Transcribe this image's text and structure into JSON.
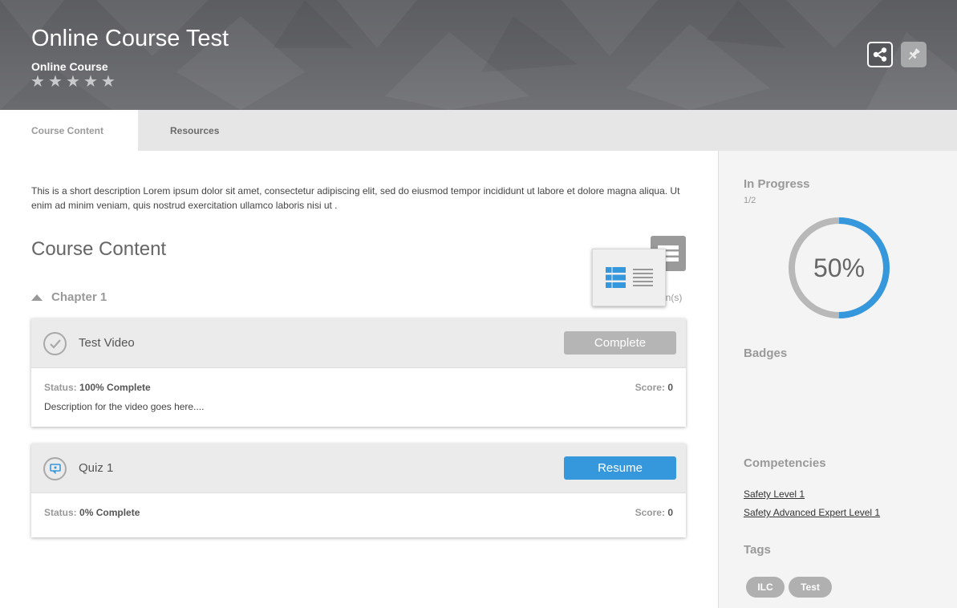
{
  "header": {
    "title": "Online Course Test",
    "type_label": "Online Course",
    "rating": {
      "stars_total": 5,
      "stars_filled": 0,
      "star_glyphs": [
        "★",
        "★",
        "★",
        "★",
        "★"
      ]
    },
    "share_icon": "share-icon",
    "pin_icon": "pin-icon"
  },
  "tabs": [
    {
      "label": "Course Content",
      "active": true
    },
    {
      "label": "Resources",
      "active": false
    }
  ],
  "main": {
    "description": "This is a short description Lorem ipsum dolor sit amet, consectetur adipiscing elit, sed do eiusmod tempor incididunt ut labore et dolore magna aliqua. Ut enim ad minim veniam, quis nostrud exercitation ullamco laboris nisi ut .",
    "section_title": "Course Content",
    "chapter": {
      "label": "Chapter 1",
      "lessons_suffix": "on(s)"
    },
    "items": [
      {
        "title": "Test Video",
        "button_label": "Complete",
        "status_label": "Status:",
        "status_value": "100% Complete",
        "score_label": "Score:",
        "score_value": "0",
        "description": "Description for the video goes here...."
      },
      {
        "title": "Quiz 1",
        "button_label": "Resume",
        "status_label": "Status:",
        "status_value": "0% Complete",
        "score_label": "Score:",
        "score_value": "0"
      }
    ]
  },
  "sidebar": {
    "progress_heading": "In Progress",
    "progress_fraction": "1/2",
    "progress_percent_label": "50%",
    "progress_value": 0.5,
    "badges_heading": "Badges",
    "competencies_heading": "Competencies",
    "competencies": [
      "Safety Level 1",
      "Safety Advanced Expert Level 1"
    ],
    "tags_heading": "Tags",
    "tags": [
      "ILC",
      "Test"
    ]
  },
  "colors": {
    "accent": "#3598dc",
    "header_bg": "#6b6c70",
    "button_disabled": "#b5b5b5",
    "donut_track": "#b8b8b8"
  }
}
